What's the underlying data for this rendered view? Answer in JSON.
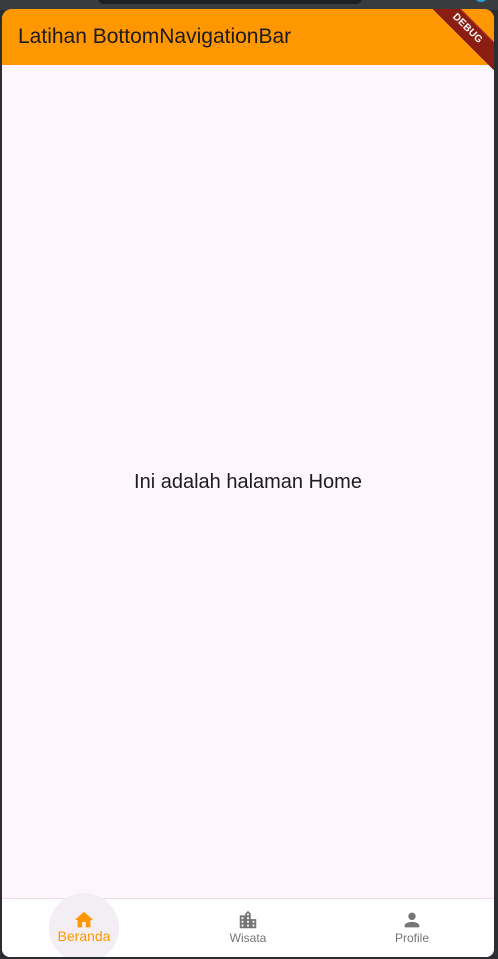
{
  "app_bar": {
    "title": "Latihan BottomNavigationBar",
    "background": "#ff9800"
  },
  "debug_banner": {
    "label": "DEBUG"
  },
  "body": {
    "message": "Ini adalah halaman Home"
  },
  "bottom_nav": {
    "active_color": "#ff9800",
    "inactive_color": "#757575",
    "items": [
      {
        "label": "Beranda",
        "icon": "home-icon",
        "active": true
      },
      {
        "label": "Wisata",
        "icon": "building-icon",
        "active": false
      },
      {
        "label": "Profile",
        "icon": "person-icon",
        "active": false
      }
    ]
  }
}
